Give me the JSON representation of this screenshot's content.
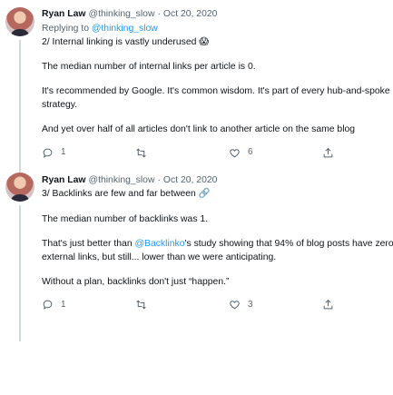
{
  "tweets": [
    {
      "author": "Ryan Law",
      "handle": "@thinking_slow",
      "separator": "·",
      "date": "Oct 20, 2020",
      "reply_prefix": "Replying to ",
      "reply_handle": "@thinking_slow",
      "line1": "2/ Internal linking is vastly underused 😱",
      "line2": "The median number of internal links per article is 0.",
      "line3": "It's recommended by Google. It's common wisdom. It's part of every hub-and-spoke strategy.",
      "line4": "And yet over half of all articles don't link to another article on the same blog",
      "counts": {
        "reply": "1",
        "retweet": "",
        "like": "6"
      }
    },
    {
      "author": "Ryan Law",
      "handle": "@thinking_slow",
      "separator": "·",
      "date": "Oct 20, 2020",
      "line1": "3/ Backlinks are few and far between 🔗",
      "line2": "The median number of backlinks was 1.",
      "line3_pre": "That's just better than ",
      "line3_link": "@Backlinko",
      "line3_post": "'s study showing that 94% of blog posts have zero external links, but still... lower than we were anticipating.",
      "line4": "Without a plan, backlinks don't just “happen.”",
      "counts": {
        "reply": "1",
        "retweet": "",
        "like": "3"
      }
    }
  ],
  "icons": {
    "more": "more-horizontal-icon",
    "reply": "reply-icon",
    "retweet": "retweet-icon",
    "like": "heart-icon",
    "share": "share-icon"
  }
}
